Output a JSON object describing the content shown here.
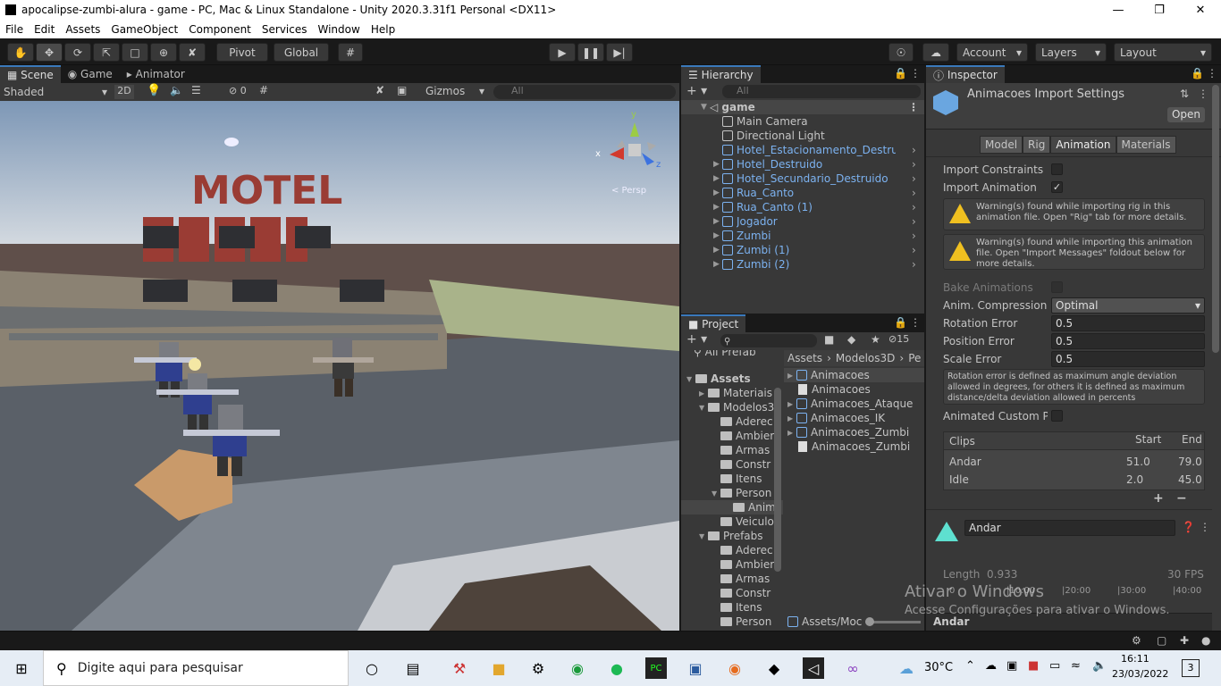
{
  "window": {
    "title": "apocalipse-zumbi-alura - game - PC, Mac & Linux Standalone - Unity 2020.3.31f1 Personal <DX11>"
  },
  "menu": [
    "File",
    "Edit",
    "Assets",
    "GameObject",
    "Component",
    "Services",
    "Window",
    "Help"
  ],
  "toolbar": {
    "pivot": "Pivot",
    "global": "Global",
    "account": "Account",
    "layers": "Layers",
    "layout": "Layout"
  },
  "scene": {
    "tabs": [
      "Scene",
      "Game",
      "Animator"
    ],
    "shading": "Shaded",
    "mode_2d": "2D",
    "hidden_count": "0",
    "gizmos": "Gizmos",
    "search_placeholder": "All",
    "persp": "< Persp",
    "axis_x": "x",
    "axis_y": "y",
    "axis_z": "z",
    "motel_sign": "MOTEL"
  },
  "hierarchy": {
    "title": "Hierarchy",
    "search_placeholder": "All",
    "scene_name": "game",
    "items": [
      {
        "label": "Main Camera",
        "blue": false,
        "arrow": false
      },
      {
        "label": "Directional Light",
        "blue": false,
        "arrow": false
      },
      {
        "label": "Hotel_Estacionamento_Destruid",
        "blue": true,
        "arrow": false
      },
      {
        "label": "Hotel_Destruido",
        "blue": true,
        "arrow": true
      },
      {
        "label": "Hotel_Secundario_Destruido",
        "blue": true,
        "arrow": true
      },
      {
        "label": "Rua_Canto",
        "blue": true,
        "arrow": true
      },
      {
        "label": "Rua_Canto (1)",
        "blue": true,
        "arrow": true
      },
      {
        "label": "Jogador",
        "blue": true,
        "arrow": true
      },
      {
        "label": "Zumbi",
        "blue": true,
        "arrow": true
      },
      {
        "label": "Zumbi (1)",
        "blue": true,
        "arrow": true
      },
      {
        "label": "Zumbi (2)",
        "blue": true,
        "arrow": true
      }
    ]
  },
  "project": {
    "title": "Project",
    "hidden_count": "15",
    "tree_top": "All Prefab",
    "breadcrumb": [
      "Assets",
      "Modelos3D",
      "Pe"
    ],
    "tree": [
      {
        "label": "Assets",
        "indent": 0,
        "arrow": "▼",
        "bold": true
      },
      {
        "label": "Materiais",
        "indent": 1,
        "arrow": "▶"
      },
      {
        "label": "Modelos3",
        "indent": 1,
        "arrow": "▼"
      },
      {
        "label": "Aderec",
        "indent": 2,
        "arrow": ""
      },
      {
        "label": "Ambier",
        "indent": 2,
        "arrow": ""
      },
      {
        "label": "Armas",
        "indent": 2,
        "arrow": ""
      },
      {
        "label": "Constr",
        "indent": 2,
        "arrow": ""
      },
      {
        "label": "Itens",
        "indent": 2,
        "arrow": ""
      },
      {
        "label": "Person",
        "indent": 2,
        "arrow": "▼"
      },
      {
        "label": "Anim",
        "indent": 3,
        "arrow": "",
        "selected": true
      },
      {
        "label": "Veiculo",
        "indent": 2,
        "arrow": ""
      },
      {
        "label": "Prefabs",
        "indent": 1,
        "arrow": "▼"
      },
      {
        "label": "Aderec",
        "indent": 2,
        "arrow": ""
      },
      {
        "label": "Ambier",
        "indent": 2,
        "arrow": ""
      },
      {
        "label": "Armas",
        "indent": 2,
        "arrow": ""
      },
      {
        "label": "Constr",
        "indent": 2,
        "arrow": ""
      },
      {
        "label": "Itens",
        "indent": 2,
        "arrow": ""
      },
      {
        "label": "Person",
        "indent": 2,
        "arrow": ""
      }
    ],
    "files": [
      {
        "label": "Animacoes",
        "kind": "model",
        "selected": true
      },
      {
        "label": "Animacoes",
        "kind": "doc"
      },
      {
        "label": "Animacoes_Ataque",
        "kind": "model"
      },
      {
        "label": "Animacoes_IK",
        "kind": "model"
      },
      {
        "label": "Animacoes_Zumbi",
        "kind": "model"
      },
      {
        "label": "Animacoes_Zumbi",
        "kind": "doc"
      }
    ],
    "footer_path": "Assets/Moc"
  },
  "inspector": {
    "title": "Inspector",
    "asset_title": "Animacoes Import Settings",
    "open": "Open",
    "tabs": [
      "Model",
      "Rig",
      "Animation",
      "Materials"
    ],
    "active_tab": "Animation",
    "import_constraints": "Import Constraints",
    "import_animation": "Import Animation",
    "warning1": "Warning(s) found while importing rig in this animation file. Open \"Rig\" tab for more details.",
    "warning2": "Warning(s) found while importing this animation file. Open \"Import Messages\" foldout below for more details.",
    "bake_animations": "Bake Animations",
    "anim_compression": "Anim. Compression",
    "anim_compression_value": "Optimal",
    "rotation_error": "Rotation Error",
    "rotation_error_value": "0.5",
    "position_error": "Position Error",
    "position_error_value": "0.5",
    "scale_error": "Scale Error",
    "scale_error_value": "0.5",
    "help_text": "Rotation error is defined as maximum angle deviation allowed in degrees, for others it is defined as maximum distance/delta deviation allowed in percents",
    "animated_custom": "Animated Custom Prc",
    "clips_header": {
      "clips": "Clips",
      "start": "Start",
      "end": "End"
    },
    "clips": [
      {
        "name": "Andar",
        "start": "51.0",
        "end": "79.0"
      },
      {
        "name": "Idle",
        "start": "2.0",
        "end": "45.0"
      }
    ],
    "clip_name": "Andar",
    "length_label": "Length",
    "length_value": "0.933",
    "fps": "30 FPS",
    "timeline": [
      "|10:00",
      "|20:00",
      "|30:00",
      "|40:00"
    ],
    "timeline_start": "0",
    "preview_name": "Andar"
  },
  "watermark": {
    "line1": "Ativar o Windows",
    "line2": "Acesse Configurações para ativar o Windows."
  },
  "taskbar": {
    "search_placeholder": "Digite aqui para pesquisar",
    "temperature": "30°C",
    "time": "16:11",
    "date": "23/03/2022",
    "notifications": "3"
  }
}
